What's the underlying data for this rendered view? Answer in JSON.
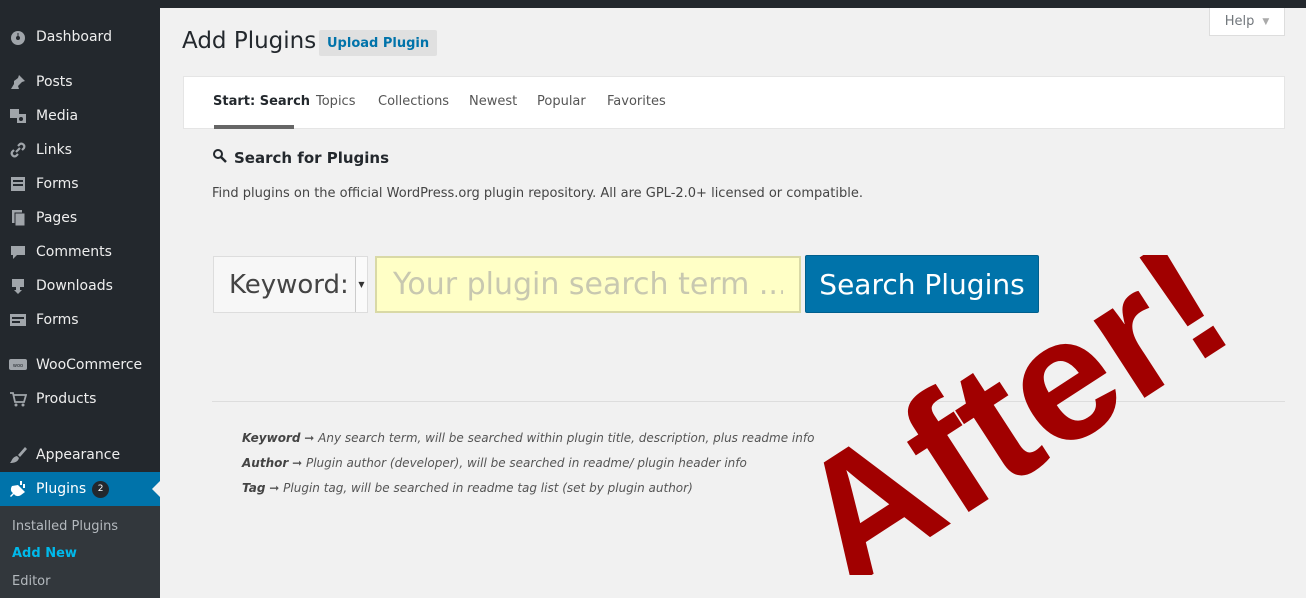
{
  "sidebar": {
    "items": [
      {
        "label": "Dashboard",
        "icon": "dashboard-icon"
      },
      {
        "label": "Posts",
        "icon": "pin-icon"
      },
      {
        "label": "Media",
        "icon": "media-icon"
      },
      {
        "label": "Links",
        "icon": "link-icon"
      },
      {
        "label": "Forms",
        "icon": "form-icon"
      },
      {
        "label": "Pages",
        "icon": "pages-icon"
      },
      {
        "label": "Comments",
        "icon": "comment-icon"
      },
      {
        "label": "Downloads",
        "icon": "download-icon"
      },
      {
        "label": "Forms",
        "icon": "form-icon"
      },
      {
        "label": "WooCommerce",
        "icon": "woo-icon"
      },
      {
        "label": "Products",
        "icon": "cart-icon"
      },
      {
        "label": "Appearance",
        "icon": "brush-icon"
      },
      {
        "label": "Plugins",
        "icon": "plugin-icon",
        "badge": "2"
      }
    ],
    "submenu": [
      "Installed Plugins",
      "Add New",
      "Editor"
    ]
  },
  "page": {
    "title": "Add Plugins",
    "upload_label": "Upload Plugin",
    "help_label": "Help"
  },
  "tabs": [
    "Start: Search",
    "Topics",
    "Collections",
    "Newest",
    "Popular",
    "Favorites"
  ],
  "search": {
    "heading": "Search for Plugins",
    "description": "Find plugins on the official WordPress.org plugin repository. All are GPL-2.0+ licensed or compatible.",
    "select_value": "Keyword:",
    "placeholder": "Your plugin search term ...",
    "button_label": "Search Plugins"
  },
  "help_lines": [
    {
      "term": "Keyword",
      "text": "➞ Any search term, will be searched within plugin title, description, plus readme info"
    },
    {
      "term": "Author",
      "text": "➞ Plugin author (developer), will be searched in readme/ plugin header info"
    },
    {
      "term": "Tag",
      "text": "➞ Plugin tag, will be searched in readme tag list (set by plugin author)"
    }
  ],
  "overlay_text": "After!",
  "colors": {
    "sidebar_bg": "#23282d",
    "accent": "#0073aa",
    "overlay": "#a10000",
    "input_bg": "#ffffc6"
  }
}
